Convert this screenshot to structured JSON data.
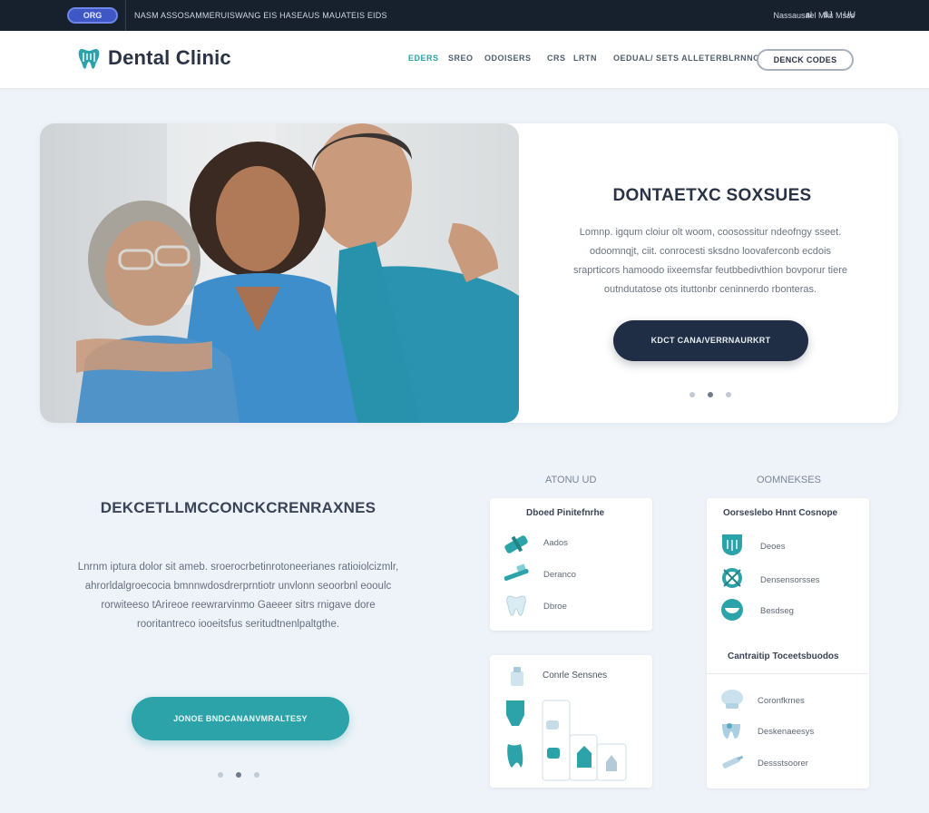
{
  "topbar": {
    "badge": "ORG",
    "text": "NASM ASSOSAMMERUISWANG EIS HASEAUS MAUATEIS EIDS",
    "right": "Nassausael Mks Msss",
    "i1": "al",
    "i2": "8J",
    "i3": "UU"
  },
  "header": {
    "logo": "Dental Clinic",
    "nav": [
      "EDERS",
      "SREO",
      "ODOISERS",
      "CRS",
      "LRTN",
      "OEDUAL/ SETS ALLETERBLRNNO"
    ],
    "cta": "DENCK CODES"
  },
  "hero": {
    "title": "DONTAETXC SOXSUES",
    "text": [
      "Lomnp. igqum cloiur olt woom, coosossitur ndeofngy sseet.",
      "odoomnqjt, ciit. conrocesti sksdno loovaferconb ecdois",
      "sraprticors hamoodo iixeemsfar feutbbedivthion bovporur tiere",
      "outndutatose ots ituttonbr ceninnerdo rbonteras."
    ],
    "button": "KDCT CANA/VERRNAURKRT"
  },
  "section": {
    "title": "DEKCETLLMCCONCKCRENRAXNES",
    "text": [
      "Lnrnm iptura dolor sit ameb. sroerocrbetinrotoneerianes ratioiolcizmlr,",
      "ahrorldalgroecocia bmnnwdosdrerprntiotr unvlonn seoorbnl eooulc",
      "rorwiteeso tArireoe reewrarvinmo Gaeeer sitrs rnigave dore",
      "rooritantreco iooeitsfus seritudtnenlpaltgthe."
    ],
    "button": "JONOE BNDCANANVMRALTESY"
  },
  "about": {
    "label": "ATONU UD",
    "card1": {
      "title": "Dboed Pinitefnrhe",
      "items": [
        {
          "icon": "floss-icon",
          "label": "Aados"
        },
        {
          "icon": "toothbrush-icon",
          "label": "Deranco"
        },
        {
          "icon": "tooth-icon",
          "label": "Dbroe"
        }
      ]
    },
    "card2": {
      "title": "Conrle Sensnes"
    }
  },
  "services": {
    "label": "OOMNEKSES",
    "card1": {
      "title": "Oorseslebo Hnnt Cosnope",
      "items": [
        {
          "icon": "aligner-icon",
          "label": "Deoes"
        },
        {
          "icon": "implant-icon",
          "label": "Densensorsses"
        },
        {
          "icon": "smile-icon",
          "label": "Besdseg"
        }
      ]
    },
    "card2": {
      "title": "Cantraitip Toceetsbuodos",
      "items": [
        {
          "icon": "cloud-icon",
          "label": "Coronfkrnes"
        },
        {
          "icon": "teeth-icon",
          "label": "Deskenaeesys"
        },
        {
          "icon": "syringe-icon",
          "label": "Dessstsoorer"
        }
      ]
    }
  },
  "colors": {
    "accent": "#2ba3a8",
    "dark": "#1f2e44",
    "topbar": "#17212e",
    "background": "#eef3f9"
  }
}
